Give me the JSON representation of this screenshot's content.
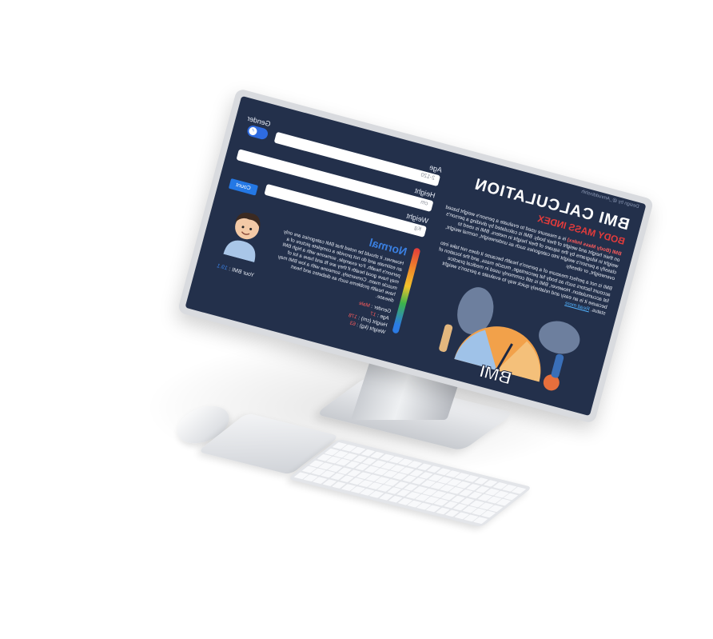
{
  "screen": {
    "brand_small": "Design by @_Amruddinshih",
    "title": "BMI CALCULATION",
    "subtitle": "BODY MASS INDEX",
    "description": {
      "lead_highlight": "BMI (Body Mass Index)",
      "body": "is a measure used to evaluate a person's weight based on their height and weight of their body. BMI is calculated by dividing a person's weight in kilograms by the square of their height in meters. BMI is used to classify a person's weight into categories such as underweight, normal weight, overweight, or obesity.",
      "body2": "BMI is not a perfect measure of a person's health because it does not take into account factors such as body fat percentage, muscle mass, and the location of fat accumulation. However, BMI is still commonly used in medical practice because it is an easy and relatively quick way to evaluate a person's weight status.",
      "link": "Read more"
    },
    "art_label": "BMI",
    "form": {
      "age_label": "Age",
      "age_placeholder": "2-120",
      "gender_label": "Gender",
      "height_label": "Height",
      "height_placeholder": "cm",
      "weight_label": "Weight",
      "weight_placeholder": "Kg",
      "count_button": "Count",
      "gender_icon": "male-symbol-icon"
    },
    "result": {
      "status": "Normal",
      "description": "However, it should be noted that BMI categories are only an estimate and do not provide a complete picture of a person's health. For example, someone with a high BMI may have good health if they are fit and have a lot of muscle mass. Conversely, someone with a low BMI may have health problems such as diabetes and heart disease.",
      "age_label": "Age :",
      "age_value": "17",
      "gender_label": "Gender :",
      "gender_value": "Male",
      "height_label": "Height (cm) :",
      "height_value": "178",
      "weight_label": "Weight (kg) :",
      "weight_value": "63",
      "bmi_label": "Your BMI :",
      "bmi_value": "19.1",
      "gauge_marker": "19.1"
    },
    "colors": {
      "background": "#23304b",
      "accent_red": "#e23b3b",
      "accent_blue": "#2478e5"
    }
  }
}
